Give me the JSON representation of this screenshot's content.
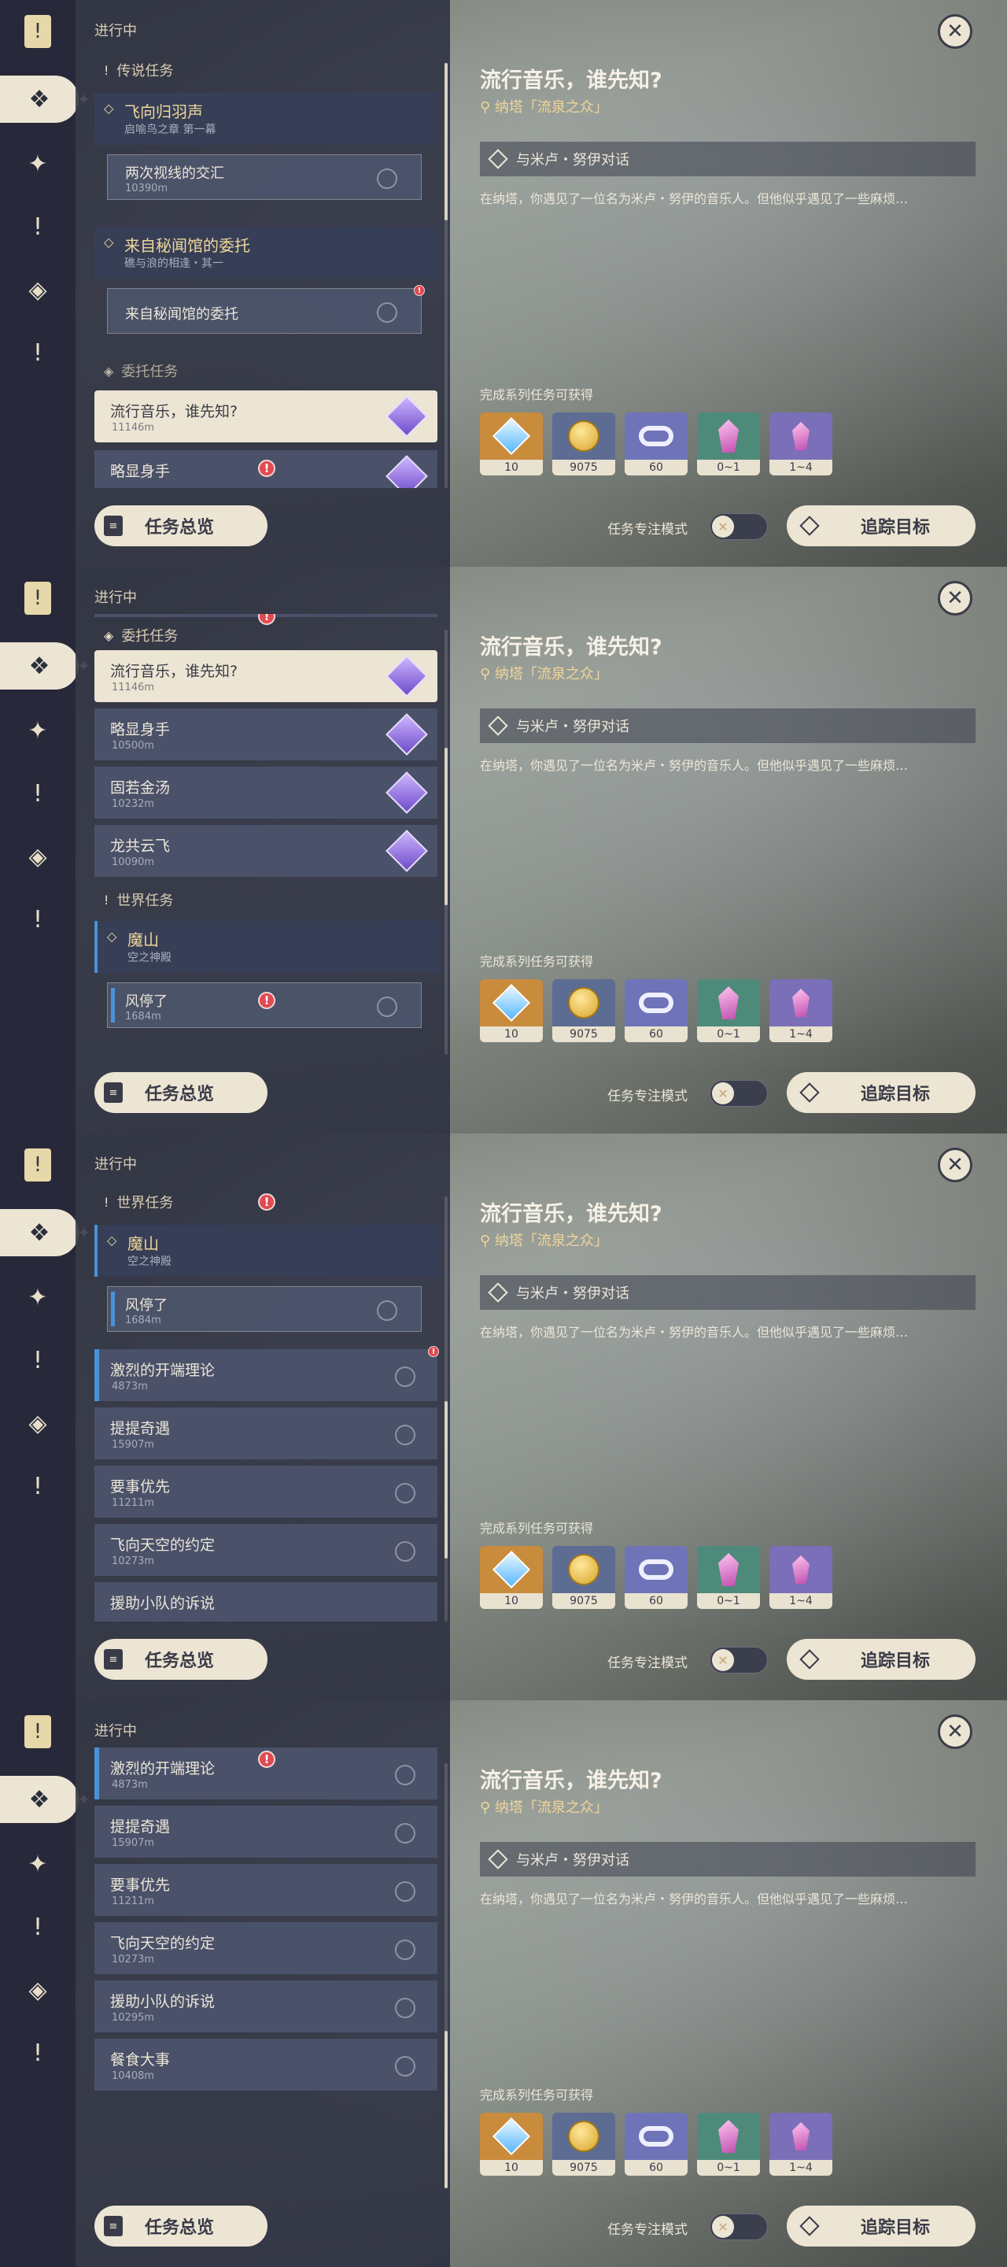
{
  "common": {
    "in_progress": "进行中",
    "quest_title": "流行音乐，谁先知?",
    "quest_location": "纳塔「流泉之众」",
    "objective": "与米卢・努伊对话",
    "description": "在纳塔，你遇见了一位名为米卢・努伊的音乐人。但他似乎遇见了一些麻烦…",
    "rewards_label": "完成系列任务可获得",
    "rewards": [
      {
        "icon": "primogem-icon",
        "count": "10"
      },
      {
        "icon": "mora-icon",
        "count": "9075"
      },
      {
        "icon": "companionship-exp-icon",
        "count": "60"
      },
      {
        "icon": "crystal-icon",
        "count": "0~1"
      },
      {
        "icon": "crystal-cluster-icon",
        "count": "1~4"
      }
    ],
    "overview_button": "任务总览",
    "focus_mode_label": "任务专注模式",
    "track_button": "追踪目标",
    "close_icon": "close-icon"
  },
  "screens": [
    {
      "categories": {
        "legend": "传说任务",
        "commission": "委托任务"
      },
      "rows": {
        "h1_title": "飞向归羽声",
        "h1_sub": "启喻鸟之章 第一幕",
        "s1_title": "两次视线的交汇",
        "s1_sub": "10390m",
        "h2_title": "来自秘闻馆的委托",
        "h2_sub": "礁与浪的相逢・其一",
        "s2_title": "来自秘闻馆的委托",
        "r1_title": "流行音乐，谁先知?",
        "r1_sub": "11146m",
        "r2_title": "略显身手"
      }
    },
    {
      "categories": {
        "commission": "委托任务",
        "world": "世界任务"
      },
      "rows": {
        "r1_title": "流行音乐，谁先知?",
        "r1_sub": "11146m",
        "r2_title": "略显身手",
        "r2_sub": "10500m",
        "r3_title": "固若金汤",
        "r3_sub": "10232m",
        "r4_title": "龙共云飞",
        "r4_sub": "10090m",
        "h_title": "魔山",
        "h_sub": "空之神殿",
        "s_title": "风停了",
        "s_sub": "1684m"
      }
    },
    {
      "categories": {
        "world": "世界任务"
      },
      "rows": {
        "h_title": "魔山",
        "h_sub": "空之神殿",
        "s_title": "风停了",
        "s_sub": "1684m",
        "r1_title": "激烈的开端理论",
        "r1_sub": "4873m",
        "r2_title": "提提奇遇",
        "r2_sub": "15907m",
        "r3_title": "要事优先",
        "r3_sub": "11211m",
        "r4_title": "飞向天空的约定",
        "r4_sub": "10273m",
        "r5_title": "援助小队的诉说"
      }
    },
    {
      "rows": {
        "r1_title": "激烈的开端理论",
        "r1_sub": "4873m",
        "r2_title": "提提奇遇",
        "r2_sub": "15907m",
        "r3_title": "要事优先",
        "r3_sub": "11211m",
        "r4_title": "飞向天空的约定",
        "r4_sub": "10273m",
        "r5_title": "援助小队的诉说",
        "r5_sub": "10295m",
        "r6_title": "餐食大事",
        "r6_sub": "10408m"
      }
    }
  ]
}
